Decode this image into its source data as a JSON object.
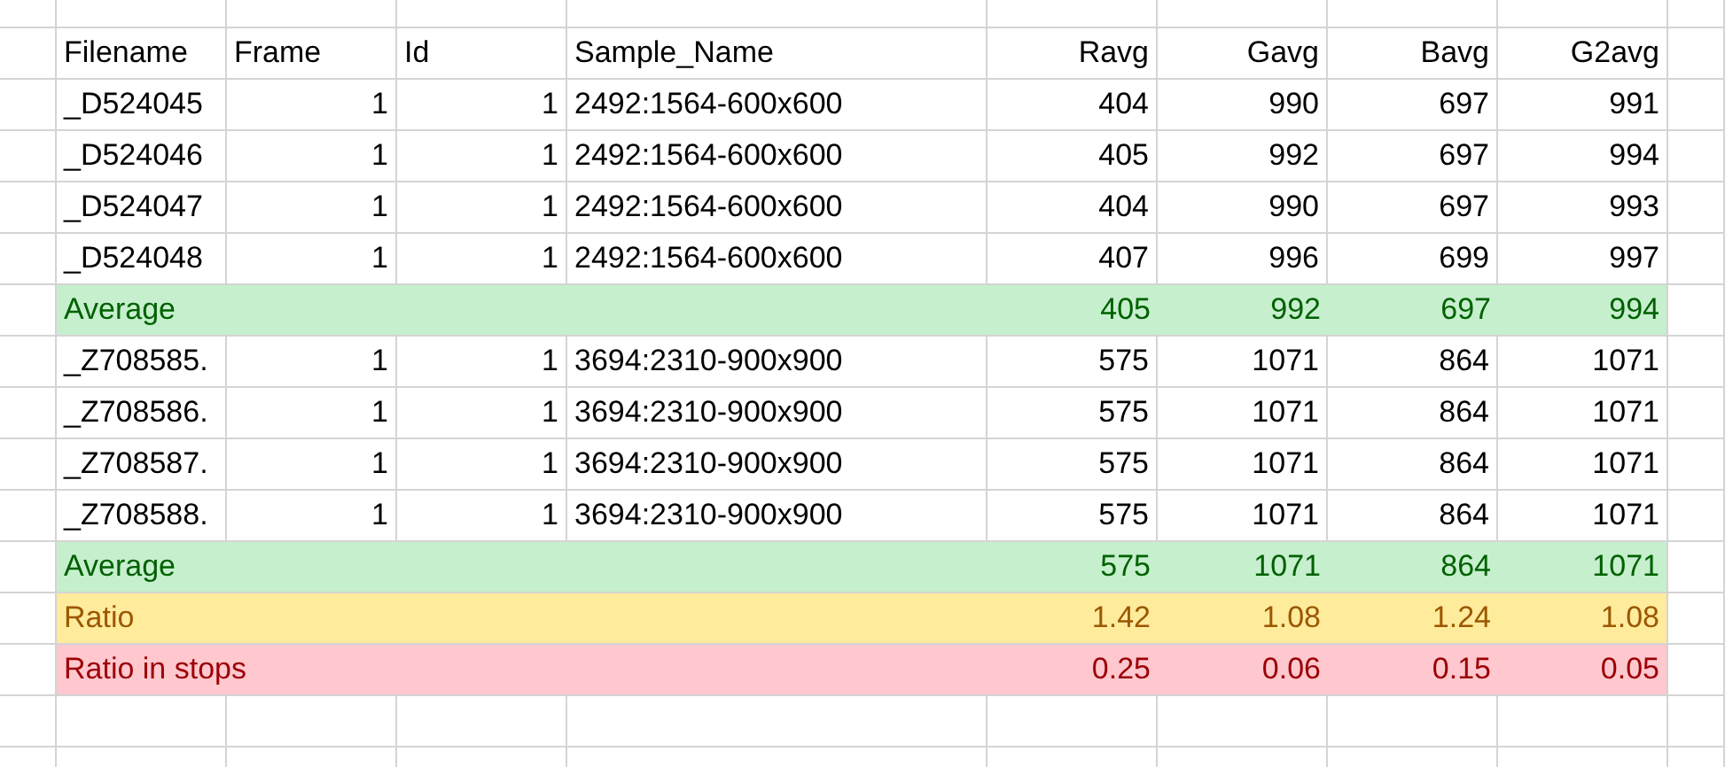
{
  "table": {
    "columns": [
      "Filename",
      "Frame",
      "Id",
      "Sample_Name",
      "Ravg",
      "Gavg",
      "Bavg",
      "G2avg"
    ],
    "rows": [
      {
        "kind": "data",
        "cells": [
          "_D524045",
          "1",
          "1",
          "2492:1564-600x600",
          "404",
          "990",
          "697",
          "991"
        ]
      },
      {
        "kind": "data",
        "cells": [
          "_D524046",
          "1",
          "1",
          "2492:1564-600x600",
          "405",
          "992",
          "697",
          "994"
        ]
      },
      {
        "kind": "data",
        "cells": [
          "_D524047",
          "1",
          "1",
          "2492:1564-600x600",
          "404",
          "990",
          "697",
          "993"
        ]
      },
      {
        "kind": "data",
        "cells": [
          "_D524048",
          "1",
          "1",
          "2492:1564-600x600",
          "407",
          "996",
          "699",
          "997"
        ]
      },
      {
        "kind": "average",
        "label": "Average",
        "values": [
          "405",
          "992",
          "697",
          "994"
        ]
      },
      {
        "kind": "data",
        "cells": [
          "_Z708585.",
          "1",
          "1",
          "3694:2310-900x900",
          "575",
          "1071",
          "864",
          "1071"
        ]
      },
      {
        "kind": "data",
        "cells": [
          "_Z708586.",
          "1",
          "1",
          "3694:2310-900x900",
          "575",
          "1071",
          "864",
          "1071"
        ]
      },
      {
        "kind": "data",
        "cells": [
          "_Z708587.",
          "1",
          "1",
          "3694:2310-900x900",
          "575",
          "1071",
          "864",
          "1071"
        ]
      },
      {
        "kind": "data",
        "cells": [
          "_Z708588.",
          "1",
          "1",
          "3694:2310-900x900",
          "575",
          "1071",
          "864",
          "1071"
        ]
      },
      {
        "kind": "average",
        "label": "Average",
        "values": [
          "575",
          "1071",
          "864",
          "1071"
        ]
      },
      {
        "kind": "ratio",
        "label": "Ratio",
        "values": [
          "1.42",
          "1.08",
          "1.24",
          "1.08"
        ]
      },
      {
        "kind": "stops",
        "label": "Ratio in stops",
        "values": [
          "0.25",
          "0.06",
          "0.15",
          "0.05"
        ]
      }
    ]
  }
}
